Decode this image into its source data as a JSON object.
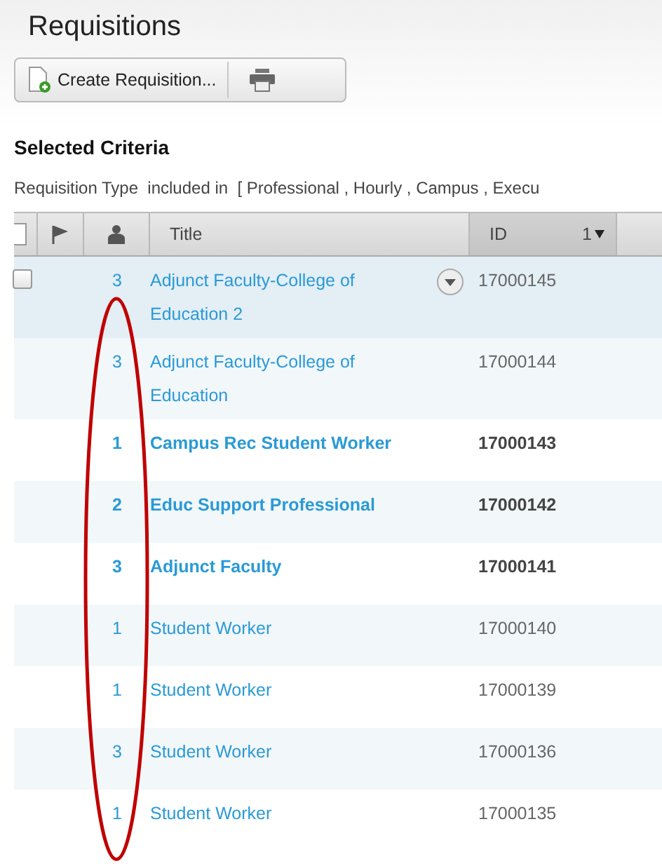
{
  "page": {
    "title": "Requisitions"
  },
  "toolbar": {
    "create_button": "Create Requisition..."
  },
  "criteria": {
    "heading": "Selected Criteria",
    "text": "Requisition Type  included in  [ Professional , Hourly , Campus , Execu"
  },
  "table": {
    "columns": [
      {
        "kind": "checkbox",
        "checked": false
      },
      {
        "kind": "flag"
      },
      {
        "kind": "person"
      },
      {
        "kind": "text",
        "label": "Title"
      },
      {
        "kind": "sort",
        "label": "ID",
        "sort_order": "1",
        "selected": true
      }
    ],
    "rows": [
      {
        "count": "3",
        "title": "Adjunct Faculty-College of Education 2",
        "id": "17000145",
        "bold": false,
        "hovered": true,
        "checked": false
      },
      {
        "count": "3",
        "title": "Adjunct Faculty-College of Education",
        "id": "17000144",
        "bold": false,
        "hovered": false
      },
      {
        "count": "1",
        "title": "Campus Rec Student Worker",
        "id": "17000143",
        "bold": true,
        "hovered": false
      },
      {
        "count": "2",
        "title": "Educ Support Professional",
        "id": "17000142",
        "bold": true,
        "hovered": false
      },
      {
        "count": "3",
        "title": "Adjunct Faculty",
        "id": "17000141",
        "bold": true,
        "hovered": false
      },
      {
        "count": "1",
        "title": "Student Worker",
        "id": "17000140",
        "bold": false,
        "hovered": false
      },
      {
        "count": "1",
        "title": "Student Worker",
        "id": "17000139",
        "bold": false,
        "hovered": false
      },
      {
        "count": "3",
        "title": "Student Worker",
        "id": "17000136",
        "bold": false,
        "hovered": false
      },
      {
        "count": "1",
        "title": "Student Worker",
        "id": "17000135",
        "bold": false,
        "hovered": false
      }
    ]
  },
  "annotation": {
    "kind": "ellipse",
    "color": "#c00000"
  }
}
